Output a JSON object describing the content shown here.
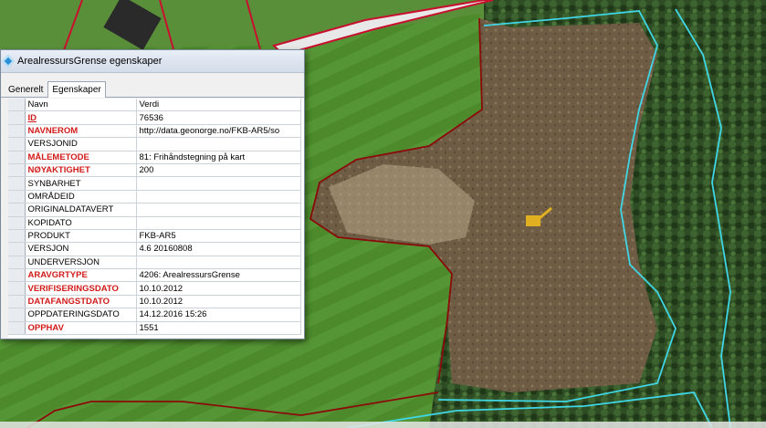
{
  "dialog": {
    "title": "ArealressursGrense egenskaper",
    "tabs": [
      {
        "label": "Generelt",
        "active": false
      },
      {
        "label": "Egenskaper",
        "active": true
      }
    ],
    "columns": {
      "name": "Navn",
      "value": "Verdi"
    },
    "rows": [
      {
        "name": "ID",
        "value": "76536",
        "required": true,
        "is_key": true
      },
      {
        "name": "NAVNEROM",
        "value": "http://data.geonorge.no/FKB-AR5/so",
        "required": true
      },
      {
        "name": "VERSJONID",
        "value": "",
        "required": false
      },
      {
        "name": "MÅLEMETODE",
        "value": "81: Frihåndstegning på kart",
        "required": true
      },
      {
        "name": "NØYAKTIGHET",
        "value": "200",
        "required": true
      },
      {
        "name": "SYNBARHET",
        "value": "",
        "required": false
      },
      {
        "name": "OMRÅDEID",
        "value": "",
        "required": false
      },
      {
        "name": "ORIGINALDATAVERT",
        "value": "",
        "required": false
      },
      {
        "name": "KOPIDATO",
        "value": "",
        "required": false
      },
      {
        "name": "PRODUKT",
        "value": "FKB-AR5",
        "required": false
      },
      {
        "name": "VERSJON",
        "value": "4.6 20160808",
        "required": false
      },
      {
        "name": "UNDERVERSJON",
        "value": "",
        "required": false
      },
      {
        "name": "ARAVGRTYPE",
        "value": "4206: ArealressursGrense",
        "required": true
      },
      {
        "name": "VERIFISERINGSDATO",
        "value": "10.10.2012",
        "required": true
      },
      {
        "name": "DATAFANGSTDATO",
        "value": "10.10.2012",
        "required": true
      },
      {
        "name": "OPPDATERINGSDATO",
        "value": "14.12.2016 15:26",
        "required": false
      },
      {
        "name": "OPPHAV",
        "value": "1551",
        "required": true
      }
    ]
  },
  "map": {
    "grass_color": "#4f8a2e",
    "forest_color": "#2a4a22",
    "clearing_color": "#7a6a50",
    "road_color": "#ececec",
    "boundary_red": "#c8102e",
    "boundary_darkred": "#8b0a0a",
    "boundary_cyan": "#3fd6e6"
  },
  "colors": {
    "required_text": "#d11a1a"
  }
}
